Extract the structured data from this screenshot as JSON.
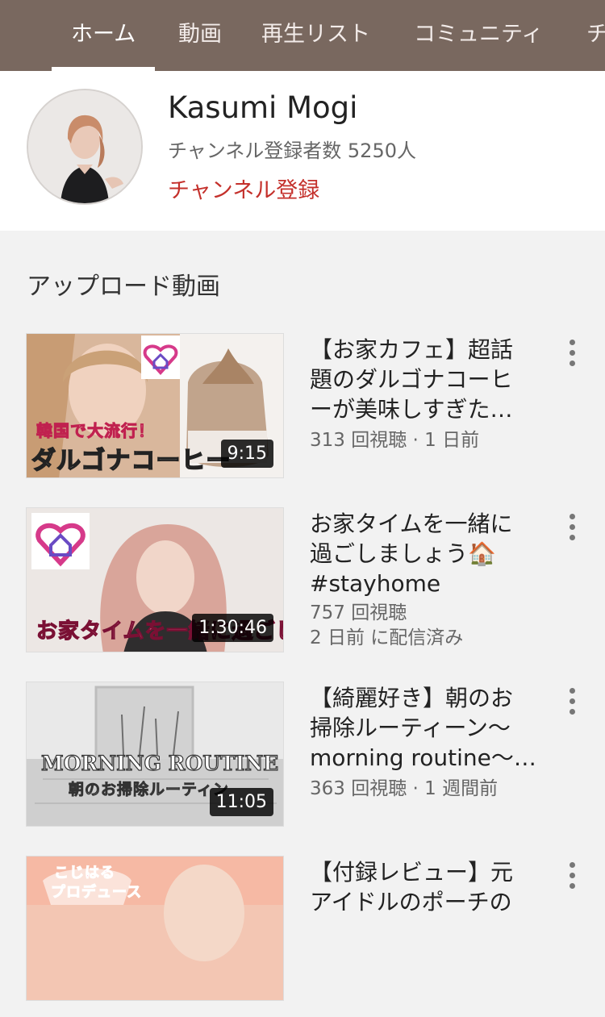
{
  "tabs": [
    {
      "label": "ホーム",
      "active": true
    },
    {
      "label": "動画",
      "active": false
    },
    {
      "label": "再生リスト",
      "active": false
    },
    {
      "label": "コミュニティ",
      "active": false
    },
    {
      "label": "チ",
      "active": false
    }
  ],
  "channel": {
    "name": "Kasumi Mogi",
    "subscribers": "チャンネル登録者数 5250人",
    "subscribe_label": "チャンネル登録"
  },
  "section": {
    "title": "アップロード動画"
  },
  "videos": [
    {
      "title_lines": [
        "【お家カフェ】超話",
        "題のダルゴナコーヒ",
        "ーが美味しすぎた…"
      ],
      "meta_lines": [
        "313 回視聴 · 1 日前"
      ],
      "duration": "9:15",
      "overlay_lines": [
        "韓国で大流行！",
        "ダルゴナコーヒー"
      ]
    },
    {
      "title_lines": [
        "お家タイムを一緒に",
        "過ごしましょう🏠",
        "#stayhome"
      ],
      "meta_lines": [
        "757 回視聴",
        "2 日前 に配信済み"
      ],
      "duration": "1:30:46",
      "overlay_lines": [
        "お家タイムを一緒に過ごしましょ"
      ]
    },
    {
      "title_lines": [
        "【綺麗好き】朝のお",
        "掃除ルーティーン〜",
        "morning routine〜…"
      ],
      "meta_lines": [
        "363 回視聴 · 1 週間前"
      ],
      "duration": "11:05",
      "overlay_lines": [
        "MORNING ROUTINE",
        "朝のお掃除ルーティン"
      ]
    },
    {
      "title_lines": [
        "【付録レビュー】元",
        "アイドルのポーチの"
      ],
      "meta_lines": [],
      "duration": "",
      "overlay_lines": [
        "こじはる",
        "プロデュース"
      ]
    }
  ],
  "colors": {
    "tabbar_bg": "#79685f",
    "subscribe": "#c4302b",
    "background": "#f2f2f2"
  }
}
